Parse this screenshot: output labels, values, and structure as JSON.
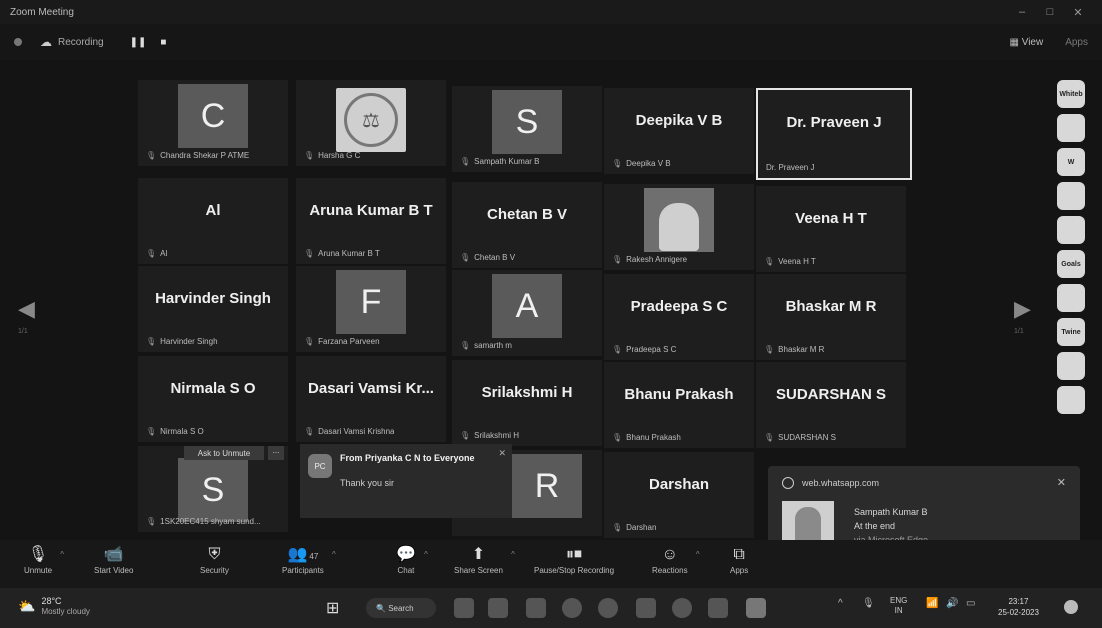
{
  "window": {
    "title": "Zoom Meeting",
    "controls": [
      "–",
      "□",
      "✕"
    ]
  },
  "topbar": {
    "recording_label": "Recording",
    "pause_glyph": "❚❚",
    "stop_glyph": "■",
    "view_label": "View",
    "apps_label": "Apps"
  },
  "tiles": [
    {
      "avatar_letter": "C",
      "name": "Chandra Shekar P ATME"
    },
    {
      "avatar_type": "logo",
      "name": "Harsha G C"
    },
    {
      "avatar_letter": "S",
      "name": "Sampath Kumar B"
    },
    {
      "display": "Deepika V B",
      "name": "Deepika V B"
    },
    {
      "display": "Dr. Praveen J",
      "name": "Dr. Praveen J",
      "active": true
    },
    {
      "display": "Al",
      "name": "Al"
    },
    {
      "display": "Aruna Kumar B T",
      "name": "Aruna Kumar B T"
    },
    {
      "display": "Chetan B V",
      "name": "Chetan B V"
    },
    {
      "avatar_type": "photo",
      "name": "Rakesh Annigere"
    },
    {
      "display": "Veena H T",
      "name": "Veena H T"
    },
    {
      "display": "Harvinder Singh",
      "name": "Harvinder Singh"
    },
    {
      "avatar_letter": "F",
      "name": "Farzana Parveen"
    },
    {
      "avatar_letter": "A",
      "name": "samarth m"
    },
    {
      "display": "Pradeepa S C",
      "name": "Pradeepa S C"
    },
    {
      "display": "Bhaskar M R",
      "name": "Bhaskar M R"
    },
    {
      "display": "Nirmala S O",
      "name": "Nirmala S O"
    },
    {
      "display": "Dasari Vamsi Kr...",
      "name": "Dasari Vamsi Krishna"
    },
    {
      "display": "Srilakshmi H",
      "name": "Srilakshmi H"
    },
    {
      "display": "Bhanu Prakash",
      "name": "Bhanu Prakash"
    },
    {
      "display": "SUDARSHAN S",
      "name": "SUDARSHAN S"
    },
    {
      "avatar_letter": "S",
      "name": "1SK20EC415 shyam sund..."
    },
    {
      "avatar_letter": "R",
      "name": ""
    },
    {
      "display": "Darshan",
      "name": "Darshan"
    }
  ],
  "ask_to_unmute": "Ask to Unmute",
  "ask_more": "...",
  "chat_popup": {
    "avatar": "PC",
    "from": "From Priyanka C N to Everyone",
    "message": "Thank you sir"
  },
  "notification": {
    "site": "web.whatsapp.com",
    "sender": "Sampath Kumar B",
    "message": "At the end",
    "via": "via Microsoft Edge"
  },
  "right_rail_apps": [
    "Whiteb",
    "",
    "W",
    "",
    "",
    "Goals",
    "",
    "Twine",
    "",
    ""
  ],
  "toolbar": {
    "unmute": "Unmute",
    "start_video": "Start Video",
    "security": "Security",
    "participants": "Participants",
    "participants_count": "47",
    "chat": "Chat",
    "share_screen": "Share Screen",
    "pause_stop": "Pause/Stop Recording",
    "reactions": "Reactions",
    "apps": "Apps"
  },
  "taskbar": {
    "weather_temp": "28°C",
    "weather_desc": "Mostly cloudy",
    "search": "Search",
    "lang_1": "ENG",
    "lang_2": "IN",
    "time": "23:17",
    "date": "25-02-2023"
  }
}
